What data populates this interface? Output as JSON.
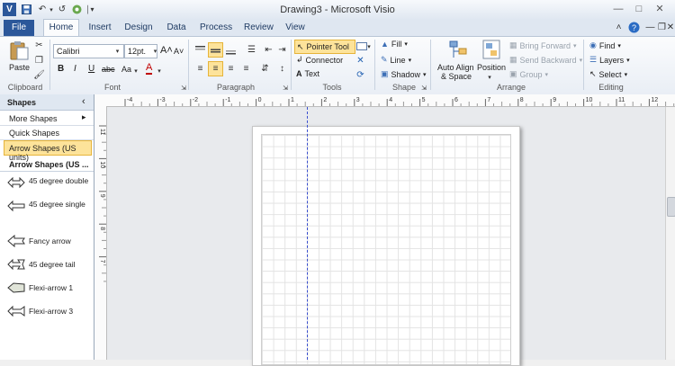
{
  "window": {
    "title": "Drawing3 - Microsoft Visio",
    "app_icon": "V"
  },
  "quick_access": {
    "customize": "│▾"
  },
  "tabs": [
    "File",
    "Home",
    "Insert",
    "Design",
    "Data",
    "Process",
    "Review",
    "View"
  ],
  "ribbon": {
    "clipboard": {
      "label": "Clipboard",
      "paste": "Paste"
    },
    "font": {
      "label": "Font",
      "family": "Calibri",
      "size": "12pt.",
      "bold": "B",
      "italic": "I",
      "underline": "U",
      "strike": "abc",
      "case": "Aa",
      "color": "A",
      "grow": "A˄",
      "shrink": "A˅"
    },
    "paragraph": {
      "label": "Paragraph"
    },
    "tools": {
      "label": "Tools",
      "pointer": "Pointer Tool",
      "connector": "Connector",
      "text": "Text"
    },
    "shape": {
      "label": "Shape",
      "fill": "Fill",
      "line": "Line",
      "shadow": "Shadow"
    },
    "arrange": {
      "label": "Arrange",
      "auto_align_1": "Auto Align",
      "auto_align_2": "& Space",
      "position": "Position",
      "bring_forward": "Bring Forward",
      "send_backward": "Send Backward",
      "group": "Group"
    },
    "editing": {
      "label": "Editing",
      "find": "Find",
      "layers": "Layers",
      "select": "Select"
    }
  },
  "shapes_panel": {
    "title": "Shapes",
    "more_shapes": "More Shapes",
    "quick_shapes": "Quick Shapes",
    "active_stencil": "Arrow Shapes (US units)",
    "stencil_header": "Arrow Shapes (US ...",
    "items": [
      "45 degree double",
      "45 degree single",
      "Fancy arrow",
      "45 degree tail",
      "Flexi-arrow 1",
      "Flexi-arrow 3"
    ]
  },
  "ruler": {
    "h_ticks": [
      "-4",
      "-3",
      "-2",
      "-1",
      "0",
      "1",
      "2",
      "3",
      "4",
      "5",
      "6",
      "7",
      "8",
      "9",
      "10",
      "11",
      "12"
    ],
    "v_ticks": [
      "11",
      "10",
      "9",
      "8",
      "7"
    ]
  },
  "colors": {
    "file_tab": "#2b579a",
    "highlight": "#fde39a",
    "guide": "#3a4fd0"
  }
}
